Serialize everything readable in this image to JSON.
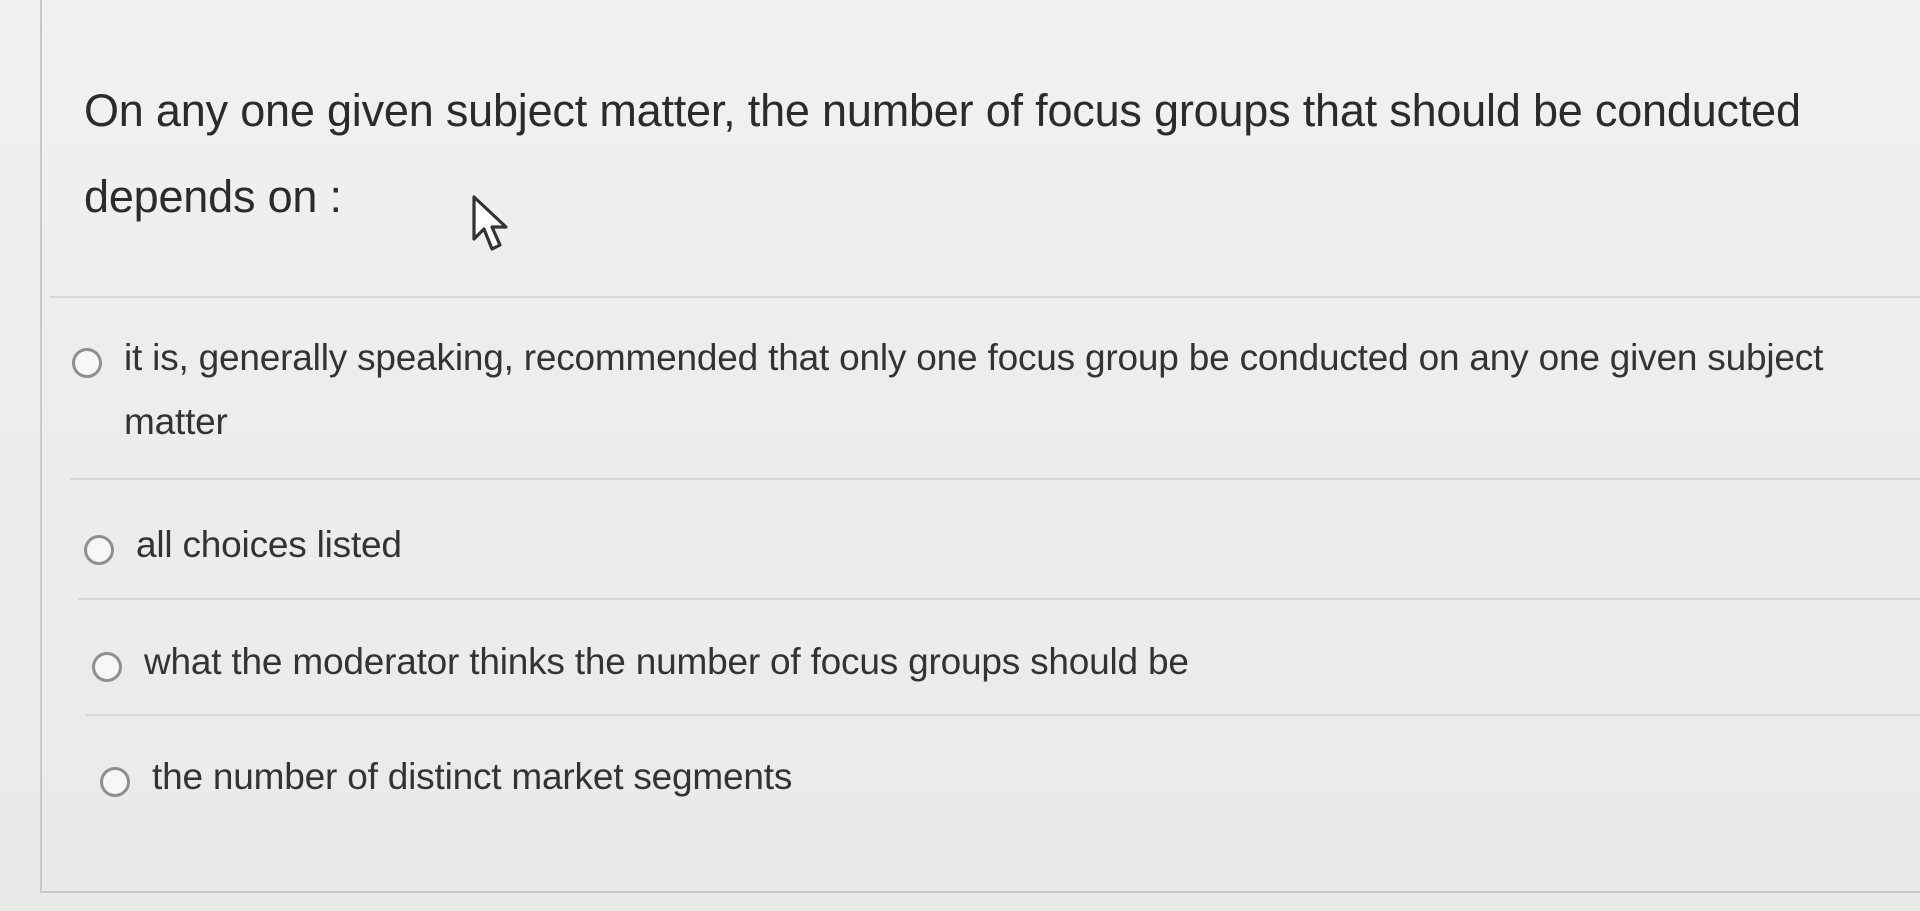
{
  "question": {
    "text": "On any one given subject matter, the number of focus groups that should be conducted depends on :"
  },
  "options": [
    {
      "label": "it is, generally speaking, recommended that only one focus group be conducted on any one given subject matter"
    },
    {
      "label": "all choices listed"
    },
    {
      "label": "what the moderator thinks the number of focus groups should be"
    },
    {
      "label": "the number of distinct market segments"
    }
  ],
  "icons": {
    "cursor": "mouse-pointer-icon",
    "radio": "radio-button-icon"
  },
  "colors": {
    "background": "#ececea",
    "text": "#2e2e2e",
    "radio_border": "#8f8f8f",
    "divider": "#d8d8d5"
  }
}
